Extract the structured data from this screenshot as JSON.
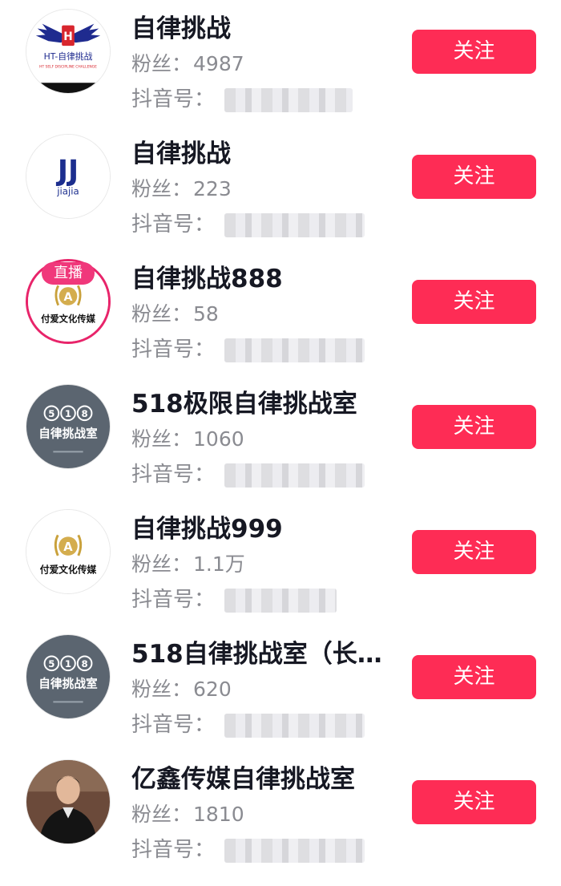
{
  "labels": {
    "fans_prefix": "粉丝：",
    "uid_prefix": "抖音号：",
    "follow": "关注",
    "live": "直播"
  },
  "colors": {
    "accent": "#fe2c55",
    "live_ring": "#e8246a",
    "secondary_text": "#8a8b91"
  },
  "users": [
    {
      "name": "自律挑战",
      "fans": "4987",
      "avatar_icon": "ht-wings-logo-icon",
      "avatar_text": "HT-自律挑战",
      "avatar_subtext": "HT SELF DISCIPLINE CHALLENGE"
    },
    {
      "name": "自律挑战",
      "fans": "223",
      "avatar_icon": "jj-logo-icon",
      "avatar_text": "jiajia"
    },
    {
      "name": "自律挑战888",
      "fans": "58",
      "avatar_icon": "gold-laurel-logo-icon",
      "avatar_text": "付爱文化传媒",
      "live": true
    },
    {
      "name": "518极限自律挑战室",
      "fans": "1060",
      "avatar_icon": "518-logo-icon",
      "avatar_text": "自律挑战室"
    },
    {
      "name": "自律挑战999",
      "fans": "1.1万",
      "avatar_icon": "gold-laurel-logo-icon",
      "avatar_text": "付爱文化传媒"
    },
    {
      "name": "518自律挑战室（长…",
      "fans": "620",
      "avatar_icon": "518-logo-icon",
      "avatar_text": "自律挑战室"
    },
    {
      "name": "亿鑫传媒自律挑战室",
      "fans": "1810",
      "avatar_icon": "person-photo-icon"
    }
  ]
}
